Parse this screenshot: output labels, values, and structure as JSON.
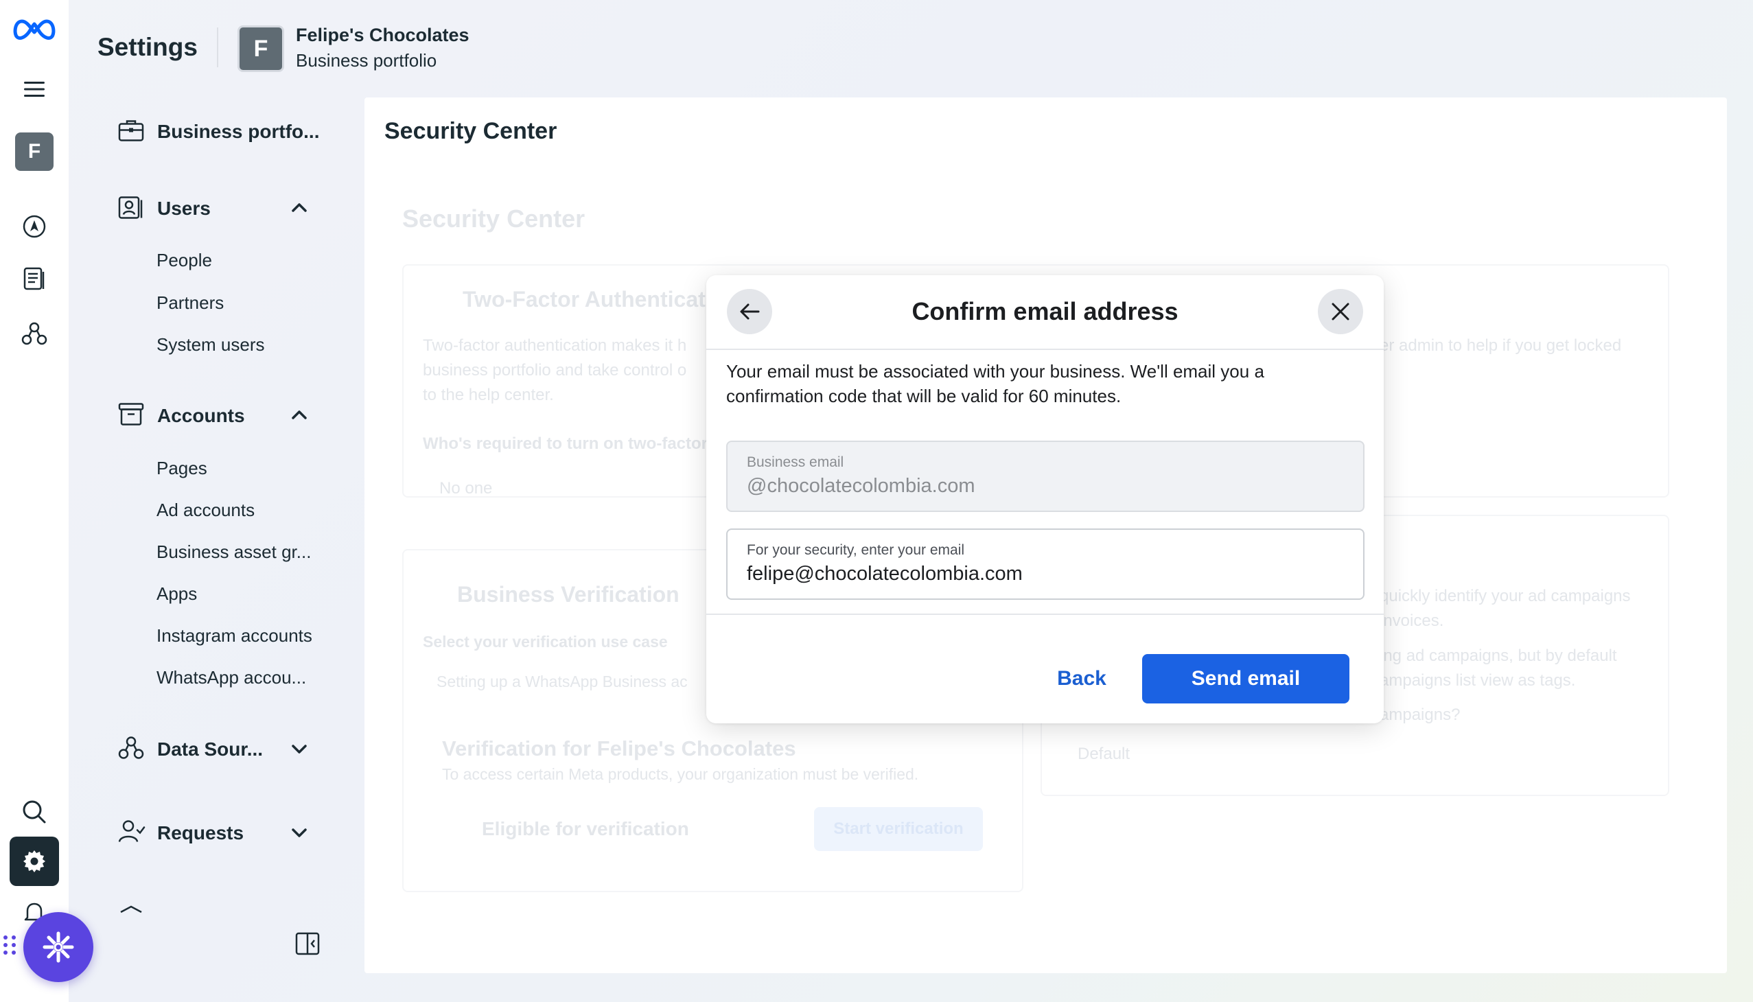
{
  "header": {
    "title": "Settings",
    "business_avatar_letter": "F",
    "business_name": "Felipe's Chocolates",
    "business_subtitle": "Business portfolio"
  },
  "rail": {
    "avatar_letter": "F",
    "icons": [
      "meta-logo-icon",
      "menu-icon",
      "navigation-icon",
      "pages-icon",
      "integrations-icon",
      "search-icon",
      "settings-icon",
      "notifications-icon",
      "help-icon"
    ]
  },
  "sidebar": {
    "business_portfolio": "Business portfo...",
    "users": {
      "label": "Users",
      "items": [
        "People",
        "Partners",
        "System users"
      ]
    },
    "accounts": {
      "label": "Accounts",
      "items": [
        "Pages",
        "Ad accounts",
        "Business asset gr...",
        "Apps",
        "Instagram accounts",
        "WhatsApp accou..."
      ]
    },
    "data_sources": "Data Sour...",
    "requests": "Requests"
  },
  "main": {
    "title": "Security Center",
    "background": {
      "heading": "Security Center",
      "two_factor_title": "Two-Factor Authenticati",
      "two_factor_desc_1": "Two-factor authentication makes it h",
      "two_factor_desc_2": "business portfolio and take control o",
      "two_factor_desc_3": "to the help center.",
      "two_factor_question": "Who's required to turn on two-factor",
      "two_factor_value": "No one",
      "right_desc_1": "er admin to help if you get locked",
      "verification_title": "Business Verification",
      "verification_usecase": "Select your verification use case",
      "verification_usecase_value": "Setting up a WhatsApp Business ac",
      "verification_for": "Verification for Felipe's Chocolates",
      "verification_note": "To access certain Meta products, your organization must be verified.",
      "eligible": "Eligible for verification",
      "start_button": "Start verification",
      "right_desc_2": "quickly identify your ad campaigns",
      "right_desc_3": "invoices.",
      "right_desc_4": "ing ad campaigns, but by default",
      "right_desc_5": "ampaigns list view as tags.",
      "right_desc_6": "ampaigns?",
      "right_select": "Default"
    }
  },
  "modal": {
    "title": "Confirm email address",
    "body": "Your email must be associated with your business. We'll email you a confirmation code that will be valid for 60 minutes.",
    "business_email_label": "Business email",
    "business_email_value": "@chocolatecolombia.com",
    "security_label": "For your security, enter your email",
    "security_value": "felipe@chocolatecolombia.com",
    "back_label": "Back",
    "send_label": "Send email"
  },
  "colors": {
    "primary_button": "#1b62e3",
    "link": "#1b5fd1",
    "active_rail": "#1c2b33",
    "assistant_fab": "#5a44e0"
  }
}
